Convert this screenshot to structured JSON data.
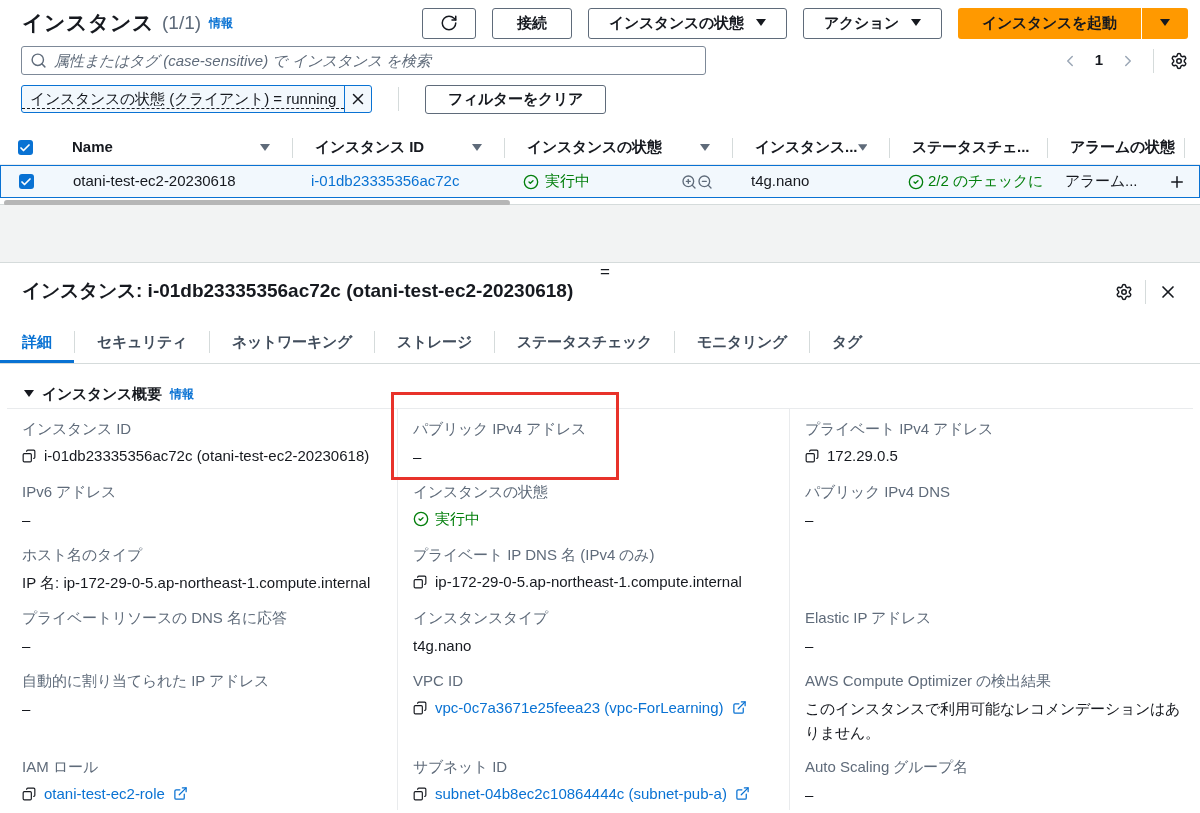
{
  "header": {
    "title": "インスタンス",
    "count": "(1/1)",
    "info": "情報",
    "buttons": [
      {
        "kind": "refresh"
      },
      {
        "kind": "text",
        "label": "接続"
      },
      {
        "kind": "dropdown",
        "label": "インスタンスの状態"
      },
      {
        "kind": "dropdown",
        "label": "アクション"
      },
      {
        "kind": "primary",
        "label": "インスタンスを起動"
      },
      {
        "kind": "primary-caret"
      }
    ]
  },
  "search": {
    "placeholder": "属性またはタグ (case-sensitive) で インスタンス を検索"
  },
  "pagination": {
    "page": "1"
  },
  "filter": {
    "token": "インスタンスの状態 (クライアント) = running",
    "clear": "フィルターをクリア"
  },
  "table": {
    "all_checked": true,
    "columns": [
      "Name",
      "インスタンス ID",
      "インスタンスの状態",
      "インスタンス...",
      "ステータスチェ...",
      "アラームの状態"
    ],
    "rows": [
      {
        "selected": true,
        "name": "otani-test-ec2-20230618",
        "id": "i-01db23335356ac72c",
        "state": "実行中",
        "type": "t4g.nano",
        "status_check": "2/2 のチェックに",
        "alarm": "アラーム..."
      }
    ]
  },
  "details": {
    "title": "インスタンス: i-01db23335356ac72c (otani-test-ec2-20230618)",
    "resize_handle": "=",
    "tabs": [
      {
        "label": "詳細",
        "selected": true
      },
      {
        "label": "セキュリティ",
        "selected": false
      },
      {
        "label": "ネットワーキング",
        "selected": false
      },
      {
        "label": "ストレージ",
        "selected": false
      },
      {
        "label": "ステータスチェック",
        "selected": false
      },
      {
        "label": "モニタリング",
        "selected": false
      },
      {
        "label": "タグ",
        "selected": false
      }
    ],
    "section": {
      "title": "インスタンス概要",
      "expanded": true,
      "info": "情報"
    },
    "rows": [
      [
        {
          "label": "インスタンス ID",
          "kind": "copy",
          "value": "i-01db23335356ac72c (otani-test-ec2-20230618)",
          "highlighted": false
        },
        {
          "label": "パブリック IPv4 アドレス",
          "kind": "text",
          "value": "–",
          "highlighted": true
        },
        {
          "label": "プライベート IPv4 アドレス",
          "kind": "copy",
          "value": "172.29.0.5",
          "highlighted": false
        }
      ],
      [
        {
          "label": "IPv6 アドレス",
          "kind": "text",
          "value": "–",
          "highlighted": false
        },
        {
          "label": "インスタンスの状態",
          "kind": "status",
          "value": "実行中",
          "highlighted": false
        },
        {
          "label": "パブリック IPv4 DNS",
          "kind": "text",
          "value": "–",
          "highlighted": false
        }
      ],
      [
        {
          "label": "ホスト名のタイプ",
          "kind": "text",
          "value": "IP 名: ip-172-29-0-5.ap-northeast-1.compute.internal",
          "highlighted": false
        },
        {
          "label": "プライベート IP DNS 名 (IPv4 のみ)",
          "kind": "copy",
          "value": "ip-172-29-0-5.ap-northeast-1.compute.internal",
          "highlighted": false
        }
      ],
      [
        {
          "label": "プライベートリソースの DNS 名に応答",
          "kind": "text",
          "value": "–",
          "highlighted": false
        },
        {
          "label": "インスタンスタイプ",
          "kind": "text",
          "value": "t4g.nano",
          "highlighted": false
        },
        {
          "label": "Elastic IP アドレス",
          "kind": "text",
          "value": "–",
          "highlighted": false
        }
      ],
      [
        {
          "label": "自動的に割り当てられた IP アドレス",
          "kind": "text",
          "value": "–",
          "highlighted": false
        },
        {
          "label": "VPC ID",
          "kind": "link",
          "value": "vpc-0c7a3671e25feea23 (vpc-ForLearning)",
          "highlighted": false
        },
        {
          "label": "AWS Compute Optimizer の検出結果",
          "kind": "text",
          "value": "このインスタンスで利用可能なレコメンデーションはありません。",
          "highlighted": false
        }
      ],
      [
        {
          "label": "IAM ロール",
          "kind": "link",
          "value": "otani-test-ec2-role",
          "highlighted": false
        },
        {
          "label": "サブネット ID",
          "kind": "link",
          "value": "subnet-04b8ec2c10864444c (subnet-pub-a)",
          "highlighted": false
        },
        {
          "label": "Auto Scaling グループ名",
          "kind": "text",
          "value": "–",
          "highlighted": false
        }
      ]
    ]
  }
}
